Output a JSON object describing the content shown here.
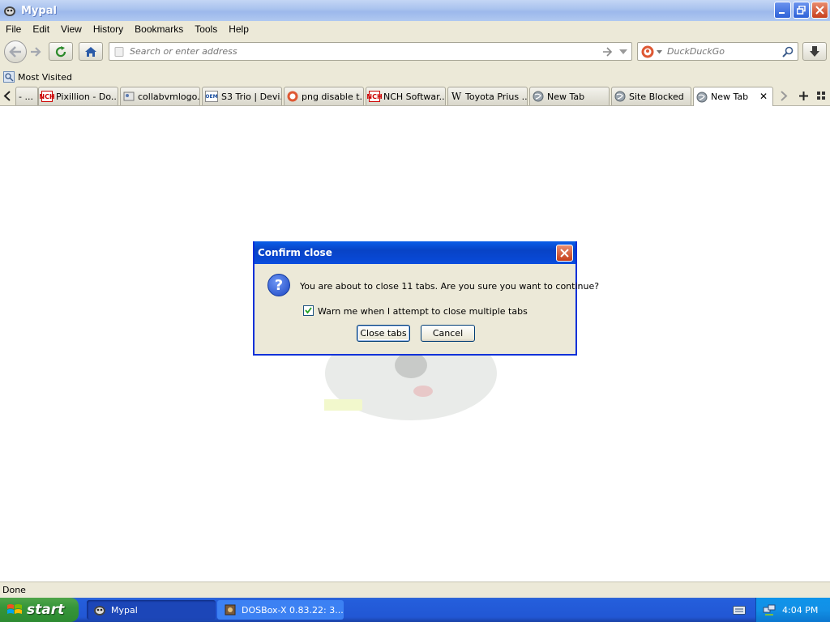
{
  "window": {
    "title": "Mypal"
  },
  "menu": [
    "File",
    "Edit",
    "View",
    "History",
    "Bookmarks",
    "Tools",
    "Help"
  ],
  "nav": {
    "url_placeholder": "Search or enter address",
    "search_placeholder": "DuckDuckGo"
  },
  "bookmarks": {
    "most_visited": "Most Visited"
  },
  "tabs": [
    {
      "label": "- ...",
      "icon": "blank"
    },
    {
      "label": "Pixillion - Do...",
      "icon": "nch-logo-icon"
    },
    {
      "label": "collabvmlogo...",
      "icon": "image-icon"
    },
    {
      "label": "S3 Trio | Devi...",
      "icon": "oem-icon"
    },
    {
      "label": "png disable t...",
      "icon": "duckduckgo-icon"
    },
    {
      "label": "NCH Softwar...",
      "icon": "nch-logo-icon"
    },
    {
      "label": "Toyota Prius ...",
      "icon": "wikipedia-icon"
    },
    {
      "label": "New Tab",
      "icon": "globe-icon"
    },
    {
      "label": "Site Blocked",
      "icon": "globe-icon"
    },
    {
      "label": "New Tab",
      "icon": "globe-icon",
      "active": true
    }
  ],
  "dialog": {
    "title": "Confirm close",
    "message": "You are about to close 11 tabs. Are you sure you want to continue?",
    "checkbox_label": "Warn me when I attempt to close multiple tabs",
    "checkbox_checked": true,
    "confirm_label": "Close tabs",
    "cancel_label": "Cancel"
  },
  "status": {
    "text": "Done"
  },
  "taskbar": {
    "start_label": "start",
    "tasks": [
      {
        "label": "Mypal",
        "active": true
      },
      {
        "label": "DOSBox-X 0.83.22: 3...",
        "active": false
      }
    ],
    "clock": "4:04 PM"
  },
  "colors": {
    "xp_blue": "#245edc",
    "dialog_title": "#0843c6",
    "start_green": "#36953a"
  }
}
